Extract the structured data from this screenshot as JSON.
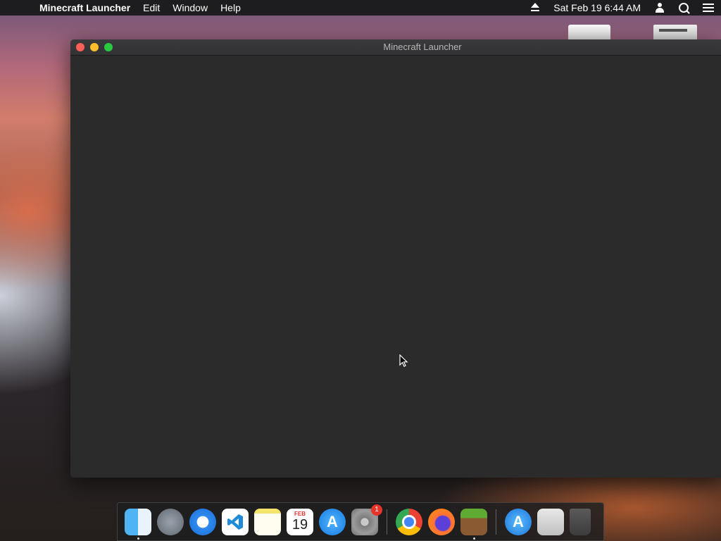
{
  "menubar": {
    "apple_glyph": "",
    "app_name": "Minecraft Launcher",
    "menus": [
      "Edit",
      "Window",
      "Help"
    ],
    "clock": "Sat Feb 19  6:44 AM"
  },
  "window": {
    "title": "Minecraft Launcher"
  },
  "dock": {
    "calendar_month": "FEB",
    "calendar_day": "19",
    "sysprefs_badge": "1",
    "items": [
      "finder",
      "launchpad",
      "safari",
      "vscode",
      "notes",
      "calendar",
      "app-store",
      "system-preferences",
      "chrome",
      "firefox",
      "minecraft",
      "app-store",
      "preview",
      "trash"
    ]
  }
}
